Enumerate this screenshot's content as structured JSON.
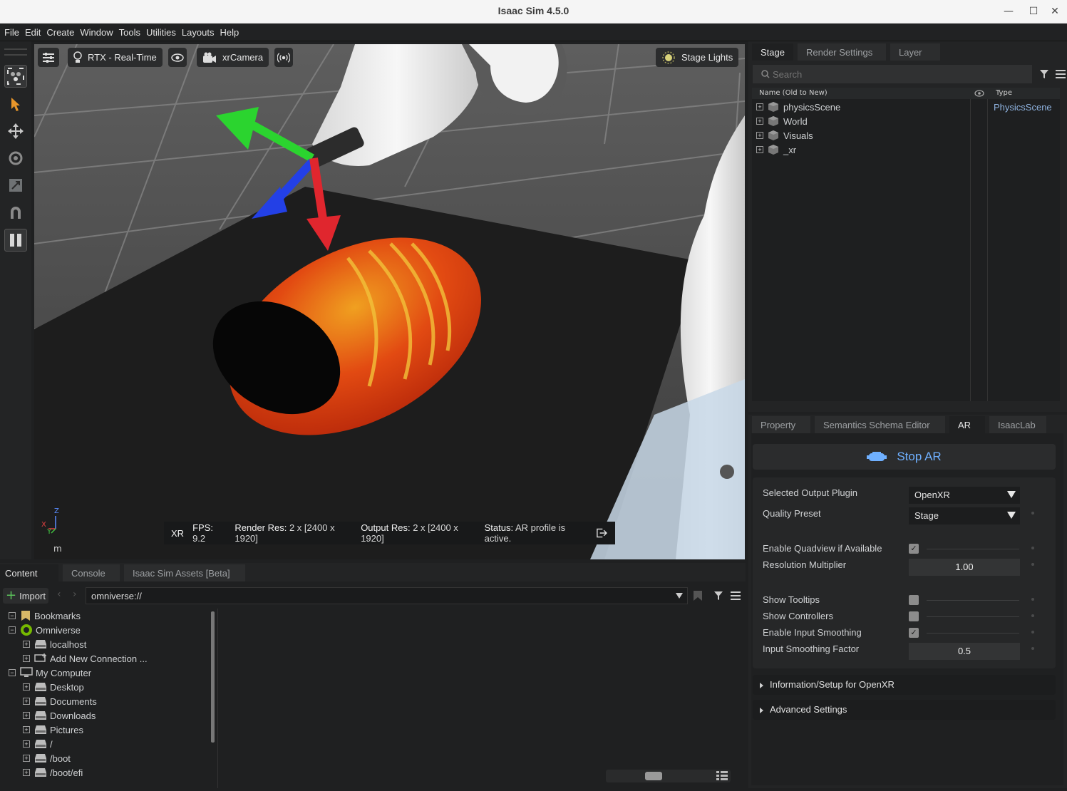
{
  "window": {
    "title": "Isaac Sim 4.5.0",
    "minimize": "—",
    "maximize": "☐",
    "close": "✕"
  },
  "menu": [
    "File",
    "Edit",
    "Create",
    "Window",
    "Tools",
    "Utilities",
    "Layouts",
    "Help"
  ],
  "viewport": {
    "render_mode": "RTX - Real-Time",
    "camera": "xrCamera",
    "lights": "Stage Lights",
    "axis_z": "Z",
    "axis_x": "X",
    "axis_y": "Y",
    "units": "m",
    "status": {
      "xr": "XR",
      "fps_label": "FPS:",
      "fps": "9.2",
      "render_res_label": "Render Res:",
      "render_res": "2 x [2400 x 1920]",
      "output_res_label": "Output Res:",
      "output_res": "2 x [2400 x 1920]",
      "status_label": "Status:",
      "status": "AR profile is active."
    }
  },
  "stage": {
    "tabs": [
      "Stage",
      "Render Settings",
      "Layer"
    ],
    "search_placeholder": "Search",
    "col_name": "Name (Old to New)",
    "col_type": "Type",
    "items": [
      {
        "name": "physicsScene",
        "type": "PhysicsScene"
      },
      {
        "name": "World",
        "type": ""
      },
      {
        "name": "Visuals",
        "type": ""
      },
      {
        "name": "_xr",
        "type": ""
      }
    ]
  },
  "property": {
    "tabs": [
      "Property",
      "Semantics Schema Editor",
      "AR",
      "IsaacLab"
    ],
    "stop_ar": "Stop AR",
    "selected_output_plugin_label": "Selected Output Plugin",
    "selected_output_plugin": "OpenXR",
    "quality_preset_label": "Quality Preset",
    "quality_preset": "Stage",
    "enable_quadview_label": "Enable Quadview if Available",
    "enable_quadview": "✓",
    "resolution_multiplier_label": "Resolution Multiplier",
    "resolution_multiplier": "1.00",
    "show_tooltips_label": "Show Tooltips",
    "show_controllers_label": "Show Controllers",
    "enable_input_smoothing_label": "Enable Input Smoothing",
    "enable_input_smoothing": "✓",
    "input_smoothing_factor_label": "Input Smoothing Factor",
    "input_smoothing_factor": "0.5",
    "info_section": "Information/Setup for OpenXR",
    "advanced_section": "Advanced Settings"
  },
  "content": {
    "tabs": [
      "Content",
      "Console",
      "Isaac Sim Assets [Beta]"
    ],
    "import": "Import",
    "path": "omniverse://",
    "tree": [
      {
        "label": "Bookmarks",
        "indent": 0,
        "expander": "−"
      },
      {
        "label": "Omniverse",
        "indent": 0,
        "expander": "−"
      },
      {
        "label": "localhost",
        "indent": 1,
        "expander": "+"
      },
      {
        "label": "Add New Connection ...",
        "indent": 1,
        "expander": "+"
      },
      {
        "label": "My Computer",
        "indent": 0,
        "expander": "−"
      },
      {
        "label": "Desktop",
        "indent": 1,
        "expander": "+"
      },
      {
        "label": "Documents",
        "indent": 1,
        "expander": "+"
      },
      {
        "label": "Downloads",
        "indent": 1,
        "expander": "+"
      },
      {
        "label": "Pictures",
        "indent": 1,
        "expander": "+"
      },
      {
        "label": "/",
        "indent": 1,
        "expander": "+"
      },
      {
        "label": "/boot",
        "indent": 1,
        "expander": "+"
      },
      {
        "label": "/boot/efi",
        "indent": 1,
        "expander": "+"
      }
    ]
  },
  "colors": {
    "accent": "#6fb0ff",
    "gizmo_x": "#e0262e",
    "gizmo_y": "#2bd42f",
    "gizmo_z": "#2340e6"
  }
}
